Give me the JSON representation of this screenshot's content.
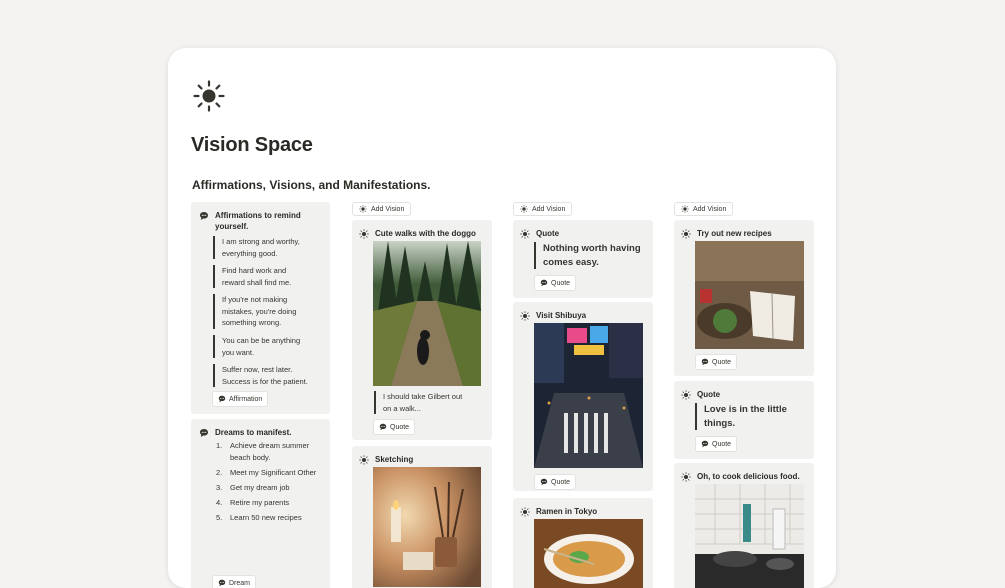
{
  "page": {
    "title": "Vision Space",
    "subtitle": "Affirmations, Visions, and Manifestations.",
    "page_icon": "sun-icon"
  },
  "column1": {
    "affirmations_card": {
      "title_line1": "Affirmations to remind",
      "title_line2": "yourself.",
      "icon": "speech-bubble-icon",
      "quotes": [
        [
          "I am strong and worthy,",
          "everything good."
        ],
        [
          "Find hard work and",
          "reward shall find me."
        ],
        [
          "If you're not making",
          "mistakes, you're doing",
          "something wrong."
        ],
        [
          "You can be be anything",
          "you want."
        ],
        [
          "Suffer now, rest later.",
          "Success is for the patient."
        ]
      ],
      "tag": "Affirmation"
    },
    "dreams_card": {
      "title": "Dreams to manifest.",
      "icon": "speech-bubble-icon",
      "items": [
        {
          "n": "1.",
          "lines": [
            "Achieve dream summer",
            "beach body."
          ]
        },
        {
          "n": "2.",
          "lines": [
            "Meet my Significant Other"
          ]
        },
        {
          "n": "3.",
          "lines": [
            "Get my dream job"
          ]
        },
        {
          "n": "4.",
          "lines": [
            "Retire my parents"
          ]
        },
        {
          "n": "5.",
          "lines": [
            "Learn 50 new recipes"
          ]
        }
      ],
      "tag": "Dream"
    }
  },
  "column2": {
    "add_label": "Add Vision",
    "cards": [
      {
        "title": "Cute walks with the doggo",
        "image": "forest-trail-dog-photo",
        "caption": [
          "I should take Gilbert out",
          "on a walk..."
        ],
        "tag": "Quote"
      },
      {
        "title": "Sketching",
        "image": "candlelit-art-desk-photo"
      }
    ]
  },
  "column3": {
    "add_label": "Add Vision",
    "cards": [
      {
        "title": "Quote",
        "quote": [
          "Nothing worth having",
          "comes easy."
        ],
        "tag": "Quote"
      },
      {
        "title": "Visit Shibuya",
        "image": "shibuya-crossing-night-photo",
        "tag": "Quote"
      },
      {
        "title": "Ramen in Tokyo",
        "image": "ramen-bowl-photo"
      }
    ]
  },
  "column4": {
    "add_label": "Add Vision",
    "cards": [
      {
        "title": "Try out new recipes",
        "image": "kitchen-cookbook-photo",
        "tag": "Quote"
      },
      {
        "title": "Quote",
        "quote": [
          "Love is in the little",
          "things."
        ],
        "tag": "Quote"
      },
      {
        "title": "Oh, to cook delicious food.",
        "image": "tiled-kitchen-stove-photo"
      }
    ]
  },
  "colors": {
    "background": "#f4f3f1",
    "card": "#f1f1ef",
    "text": "#37352f"
  }
}
